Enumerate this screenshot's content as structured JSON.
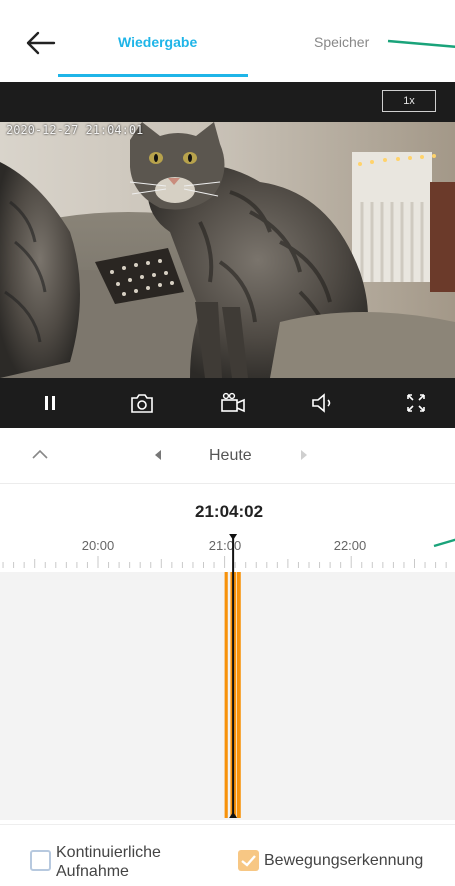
{
  "header": {
    "tabs": [
      {
        "label": "Wiedergabe",
        "active": true
      },
      {
        "label": "Speicher",
        "active": false
      }
    ],
    "accent_color": "#1fb5e8"
  },
  "player": {
    "zoom_label": "1x",
    "timestamp": "2020-12-27 21:04:01",
    "controls": [
      "pause-icon",
      "snapshot-camera-icon",
      "record-video-icon",
      "volume-icon",
      "fullscreen-icon"
    ]
  },
  "date_nav": {
    "label": "Heute"
  },
  "timeline": {
    "current_time": "21:04:02",
    "hour_labels": [
      "20:00",
      "21:00",
      "22:00"
    ],
    "recording_color": "#f7920a",
    "motion_segments": [
      {
        "start": "21:00:00",
        "end": "21:01:30"
      },
      {
        "start": "21:02:45",
        "end": "21:05:30"
      },
      {
        "start": "21:05:50",
        "end": "21:07:40"
      }
    ]
  },
  "legend": {
    "continuous": {
      "label": "Kontinuierliche Aufnahme",
      "checked": false
    },
    "motion": {
      "label": "Bewegungserkennung",
      "checked": true,
      "color": "#f7c784"
    }
  }
}
